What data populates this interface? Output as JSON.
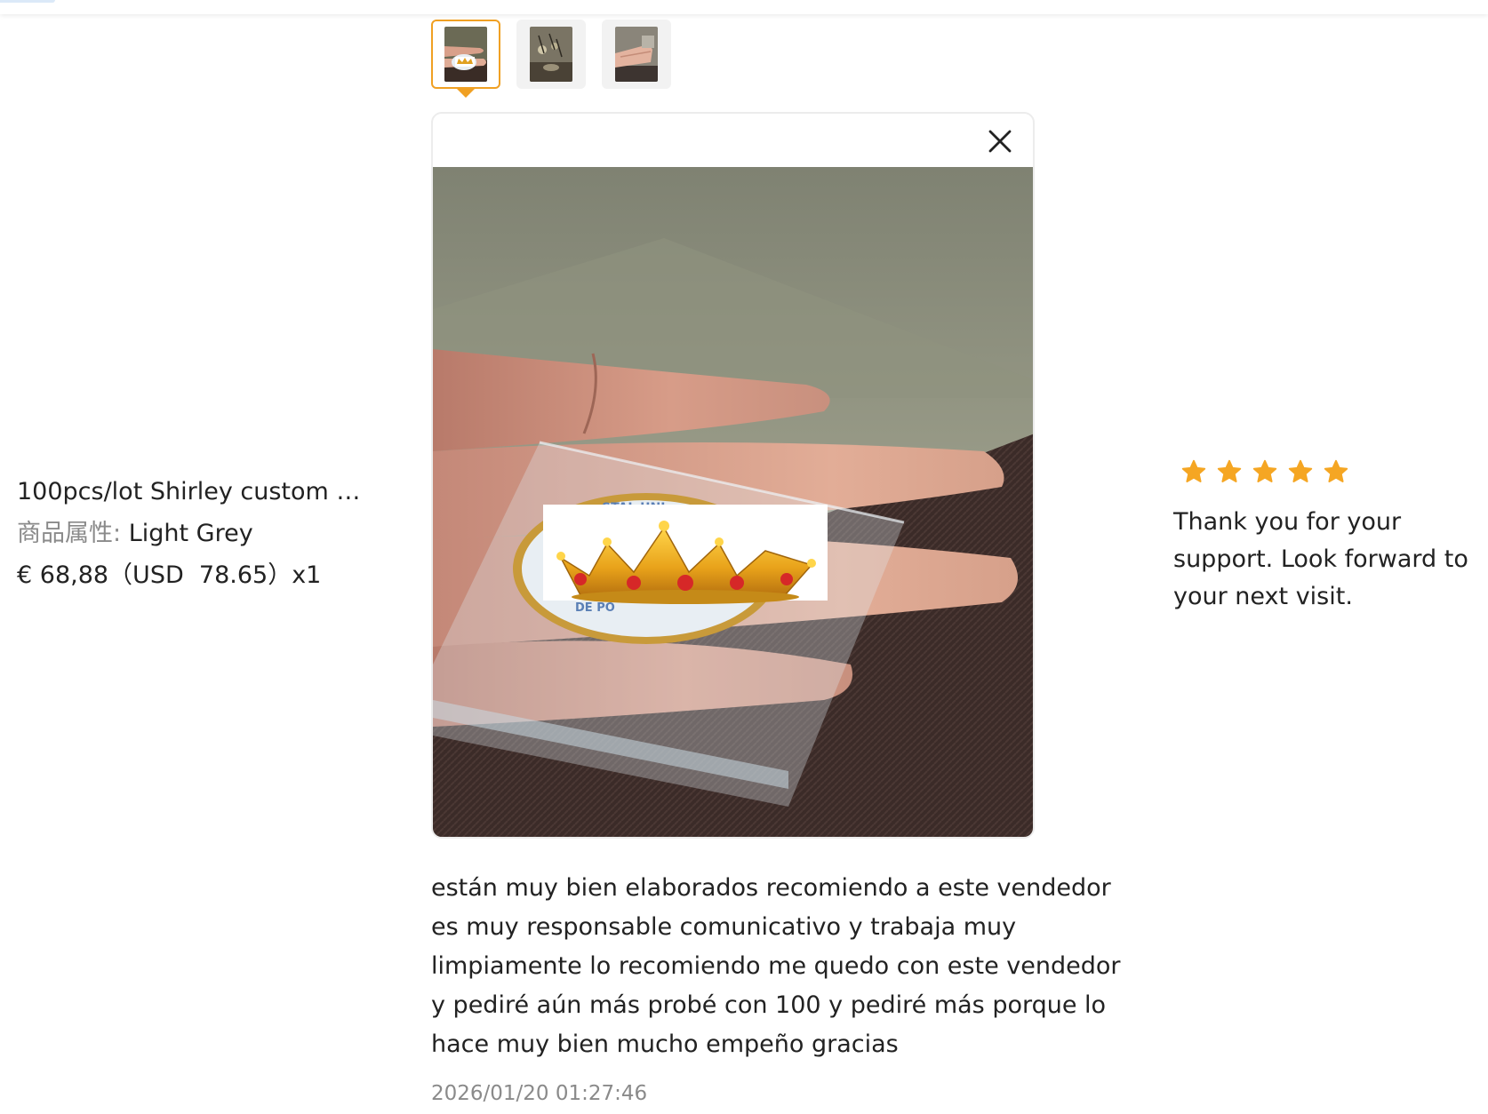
{
  "product": {
    "name": "100pcs/lot Shirley custom m...",
    "attribute_label": "商品属性:",
    "attribute_value": "Light Grey",
    "price": "€ 68,88（USD  78.65）x1"
  },
  "gallery": {
    "thumbnails": [
      {
        "name": "thumbnail-1",
        "active": true
      },
      {
        "name": "thumbnail-2",
        "active": false
      },
      {
        "name": "thumbnail-3",
        "active": false
      }
    ],
    "close_icon": "close-icon"
  },
  "review": {
    "text": "están muy bien elaborados recomiendo a este vendedor es muy responsable comunicativo y trabaja muy limpiamente lo recomiendo me quedo con este vendedor y pediré aún más probé con 100 y pediré más porque lo hace muy bien mucho empeño gracias",
    "date": "2026/01/20 01:27:46",
    "rating": 5,
    "rating_max": 5
  },
  "seller_reply": {
    "text": "Thank you for your support. Look forward to your next visit."
  },
  "colors": {
    "star": "#f5a623",
    "thumb_active_border": "#f0a023",
    "muted_text": "#8a8a8a"
  }
}
